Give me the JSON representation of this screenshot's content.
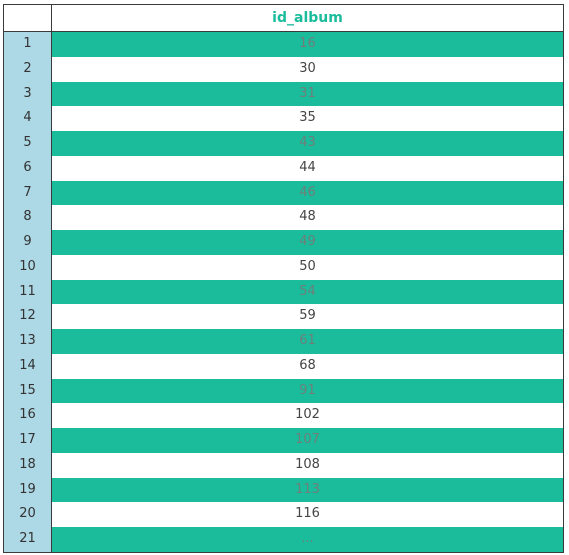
{
  "table": {
    "column_header": "id_album",
    "row_numbers": [
      "1",
      "2",
      "3",
      "4",
      "5",
      "6",
      "7",
      "8",
      "9",
      "10",
      "11",
      "12",
      "13",
      "14",
      "15",
      "16",
      "17",
      "18",
      "19",
      "20",
      "21"
    ],
    "values": [
      "16",
      "30",
      "31",
      "35",
      "43",
      "44",
      "46",
      "48",
      "49",
      "50",
      "54",
      "59",
      "61",
      "68",
      "91",
      "102",
      "107",
      "108",
      "113",
      "116",
      "..."
    ],
    "colors": {
      "header_text": "#1abc9c",
      "index_background": "#add8e6",
      "stripe": "#1abc9c"
    }
  }
}
